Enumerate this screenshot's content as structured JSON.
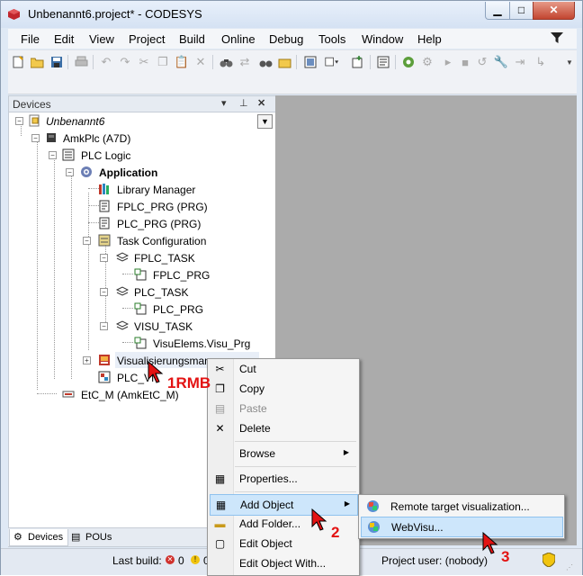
{
  "window": {
    "title": "Unbenannt6.project* - CODESYS",
    "minimize_icon": "minimize-icon",
    "maximize_icon": "maximize-icon",
    "close_icon": "close-icon",
    "min_glyph": "▁",
    "max_glyph": "□",
    "close_glyph": "✕"
  },
  "menubar": {
    "items": [
      "File",
      "Edit",
      "View",
      "Project",
      "Build",
      "Online",
      "Debug",
      "Tools",
      "Window",
      "Help"
    ]
  },
  "devices_panel": {
    "title": "Devices",
    "pin_glyph": "▾",
    "dock_glyph": "⊥",
    "close_glyph": "✕",
    "combo_glyph": "▼",
    "tree": [
      {
        "label": "Unbenannt6",
        "icon": "project-icon"
      },
      {
        "label": "AmkPlc (A7D)",
        "icon": "plc-device-icon"
      },
      {
        "label": "PLC Logic",
        "icon": "plc-logic-icon"
      },
      {
        "label": "Application",
        "icon": "application-gear-icon"
      },
      {
        "label": "Library Manager",
        "icon": "library-manager-icon"
      },
      {
        "label": "FPLC_PRG (PRG)",
        "icon": "pou-program-icon"
      },
      {
        "label": "PLC_PRG (PRG)",
        "icon": "pou-program-icon"
      },
      {
        "label": "Task Configuration",
        "icon": "task-configuration-icon"
      },
      {
        "label": "FPLC_TASK",
        "icon": "task-icon"
      },
      {
        "label": "FPLC_PRG",
        "icon": "program-call-icon"
      },
      {
        "label": "PLC_TASK",
        "icon": "task-icon"
      },
      {
        "label": "PLC_PRG",
        "icon": "program-call-icon"
      },
      {
        "label": "VISU_TASK",
        "icon": "task-icon"
      },
      {
        "label": "VisuElems.Visu_Prg",
        "icon": "program-call-icon"
      },
      {
        "label": "Visualisierungsmanag",
        "icon": "visualization-manager-icon"
      },
      {
        "label": "PLC_VI",
        "icon": "visualization-icon"
      },
      {
        "label": "EtC_M (AmkEtC_M)",
        "icon": "ethercat-master-icon"
      }
    ]
  },
  "tabs": {
    "devices": "Devices",
    "pous": "POUs"
  },
  "statusbar": {
    "last_build_label": "Last build:",
    "errors": "0",
    "warnings": "0",
    "project_user": "Project user: (nobody)"
  },
  "context_menu": {
    "items": {
      "cut": "Cut",
      "copy": "Copy",
      "paste": "Paste",
      "delete": "Delete",
      "browse": "Browse",
      "properties": "Properties...",
      "add_object": "Add Object",
      "add_folder": "Add Folder...",
      "edit_object": "Edit Object",
      "edit_object_with": "Edit Object With..."
    },
    "submenu_arrow": "▶"
  },
  "sub_menu": {
    "items": {
      "remote_target": "Remote target visualization...",
      "webvisu": "WebVisu..."
    }
  },
  "annotations": {
    "step1": "1RMB",
    "step2": "2",
    "step3": "3"
  },
  "colors": {
    "annotation_red": "#e31313",
    "highlight_blue": "#cde6fb",
    "workspace_gray": "#ababab"
  }
}
